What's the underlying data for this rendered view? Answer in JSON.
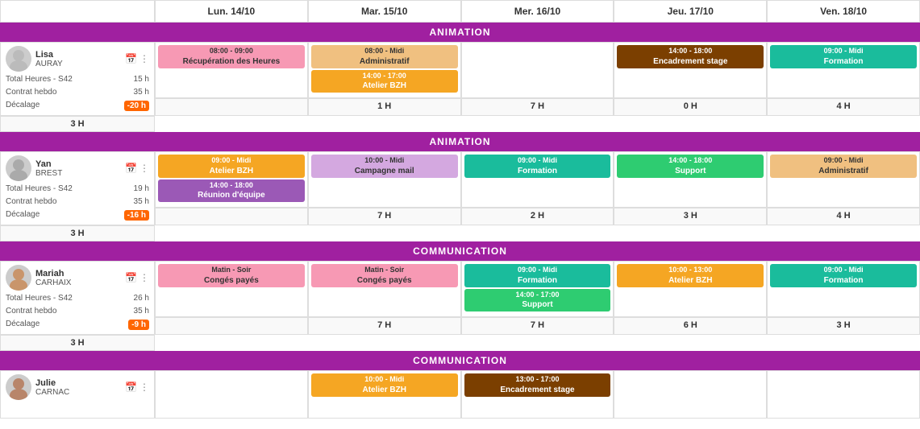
{
  "header": {
    "empty": "",
    "days": [
      {
        "label": "Lun. 14/10"
      },
      {
        "label": "Mar. 15/10"
      },
      {
        "label": "Mer. 16/10"
      },
      {
        "label": "Jeu. 17/10"
      },
      {
        "label": "Ven. 18/10"
      }
    ]
  },
  "sections": [
    {
      "id": "animation1",
      "label": "ANIMATION",
      "person": {
        "name": "Lisa",
        "surname": "AURAY",
        "avatar": "👩"
      },
      "stats": [
        {
          "label": "Total Heures - S42",
          "value": "15 h"
        },
        {
          "label": "Contrat hebdo",
          "value": "35 h"
        },
        {
          "label": "Décalage",
          "value": "-20 h",
          "badge": true
        }
      ],
      "hours": [
        "1 H",
        "7 H",
        "0 H",
        "4 H",
        "3 H"
      ],
      "days": [
        [
          {
            "time": "08:00 - 09:00",
            "label": "Récupération des Heures",
            "class": "event-pink"
          }
        ],
        [
          {
            "time": "08:00 - Midi",
            "label": "Administratif",
            "class": "event-light-orange"
          },
          {
            "time": "14:00 - 17:00",
            "label": "Atelier BZH",
            "class": "event-orange"
          }
        ],
        [],
        [
          {
            "time": "14:00 - 18:00",
            "label": "Encadrement stage",
            "class": "event-brown"
          }
        ],
        [
          {
            "time": "09:00 - Midi",
            "label": "Formation",
            "class": "event-teal"
          }
        ]
      ]
    },
    {
      "id": "animation2",
      "label": "ANIMATION",
      "person": {
        "name": "Yan",
        "surname": "BREST",
        "avatar": "🧑"
      },
      "stats": [
        {
          "label": "Total Heures - S42",
          "value": "19 h"
        },
        {
          "label": "Contrat hebdo",
          "value": "35 h"
        },
        {
          "label": "Décalage",
          "value": "-16 h",
          "badge": true
        }
      ],
      "hours": [
        "7 H",
        "2 H",
        "3 H",
        "4 H",
        "3 H"
      ],
      "days": [
        [
          {
            "time": "09:00 - Midi",
            "label": "Atelier BZH",
            "class": "event-orange"
          },
          {
            "time": "14:00 - 18:00",
            "label": "Réunion d'équipe",
            "class": "event-purple"
          }
        ],
        [
          {
            "time": "10:00 - Midi",
            "label": "Campagne mail",
            "class": "event-lavender"
          }
        ],
        [
          {
            "time": "09:00 - Midi",
            "label": "Formation",
            "class": "event-teal"
          }
        ],
        [
          {
            "time": "14:00 - 18:00",
            "label": "Support",
            "class": "event-green"
          }
        ],
        [
          {
            "time": "09:00 - Midi",
            "label": "Administratif",
            "class": "event-light-orange"
          }
        ]
      ]
    },
    {
      "id": "communication1",
      "label": "COMMUNICATION",
      "person": {
        "name": "Mariah",
        "surname": "CARHAIX",
        "avatar": "👩"
      },
      "stats": [
        {
          "label": "Total Heures - S42",
          "value": "26 h"
        },
        {
          "label": "Contrat hebdo",
          "value": "35 h"
        },
        {
          "label": "Décalage",
          "value": "-9 h",
          "badge": true
        }
      ],
      "hours": [
        "7 H",
        "7 H",
        "6 H",
        "3 H",
        "3 H"
      ],
      "days": [
        [
          {
            "time": "Matin - Soir",
            "label": "Congés payés",
            "class": "event-pink"
          }
        ],
        [
          {
            "time": "Matin - Soir",
            "label": "Congés payés",
            "class": "event-pink"
          }
        ],
        [
          {
            "time": "09:00 - Midi",
            "label": "Formation",
            "class": "event-teal"
          },
          {
            "time": "14:00 - 17:00",
            "label": "Support",
            "class": "event-green"
          }
        ],
        [
          {
            "time": "10:00 - 13:00",
            "label": "Atelier BZH",
            "class": "event-orange"
          }
        ],
        [
          {
            "time": "09:00 - Midi",
            "label": "Formation",
            "class": "event-teal"
          }
        ]
      ]
    },
    {
      "id": "communication2",
      "label": "COMMUNICATION",
      "person": {
        "name": "Julie",
        "surname": "CARNAC",
        "avatar": "👩"
      },
      "stats": [],
      "hours": [],
      "days": [
        [],
        [
          {
            "time": "10:00 - Midi",
            "label": "Atelier BZH",
            "class": "event-orange"
          }
        ],
        [
          {
            "time": "13:00 - 17:00",
            "label": "Encadrement stage",
            "class": "event-brown"
          }
        ],
        [],
        []
      ]
    }
  ]
}
